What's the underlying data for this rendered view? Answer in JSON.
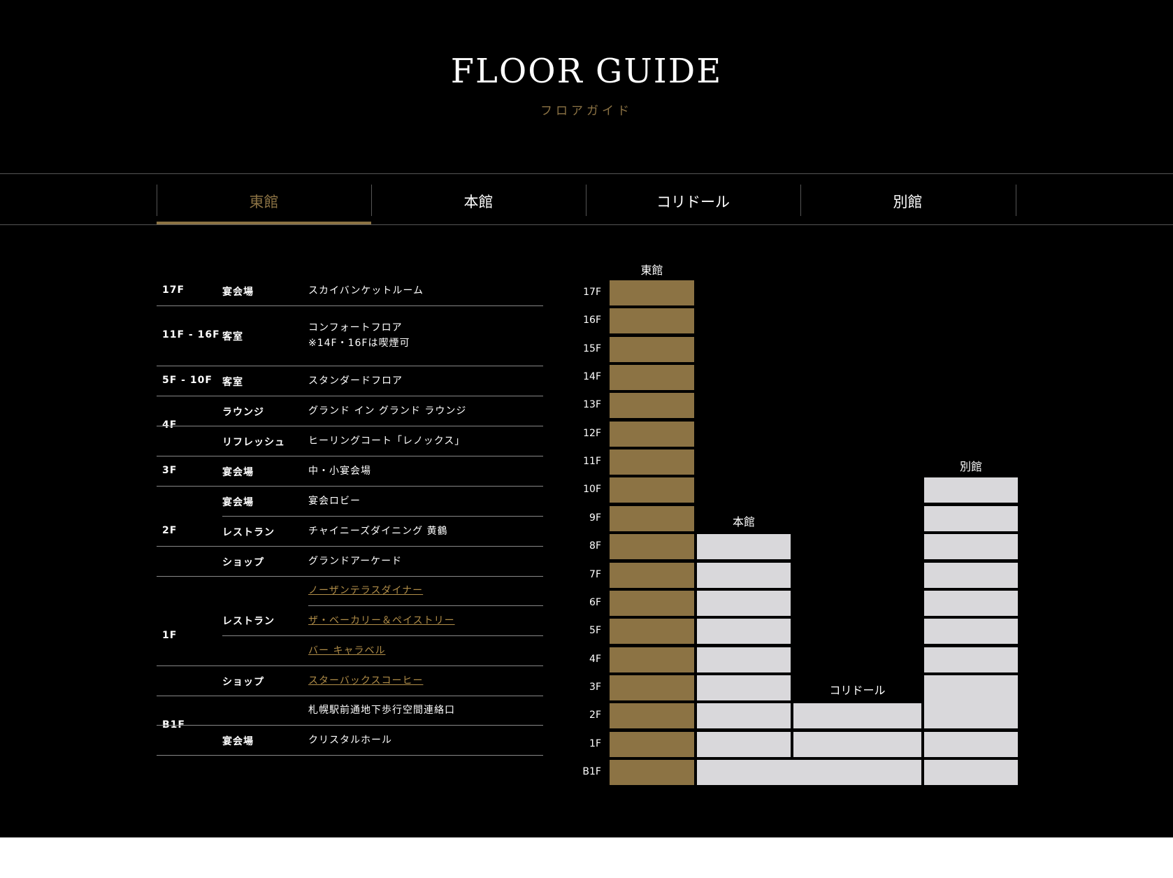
{
  "header": {
    "title": "FLOOR GUIDE",
    "subtitle": "フロアガイド"
  },
  "tabs": [
    {
      "label": "東館",
      "active": true
    },
    {
      "label": "本館",
      "active": false
    },
    {
      "label": "コリドール",
      "active": false
    },
    {
      "label": "別館",
      "active": false
    }
  ],
  "colors": {
    "accent": "#8c7344",
    "building_fill": "#d9d8db",
    "link": "#b08d48",
    "background": "#000000"
  },
  "floor_table": {
    "floors": [
      "17F",
      "11F - 16F",
      "5F - 10F",
      "4F",
      "3F",
      "2F",
      "1F",
      "B1F"
    ],
    "rows": [
      {
        "category": "宴会場",
        "name": "スカイバンケットルーム",
        "name2": ""
      },
      {
        "category": "客室",
        "name": "コンフォートフロア",
        "name2": "※14F・16Fは喫煙可"
      },
      {
        "category": "客室",
        "name": "スタンダードフロア",
        "name2": ""
      },
      {
        "category": "ラウンジ",
        "name": "グランド イン グランド ラウンジ",
        "name2": ""
      },
      {
        "category": "リフレッシュ",
        "name": "ヒーリングコート「レノックス」",
        "name2": ""
      },
      {
        "category": "宴会場",
        "name": "中・小宴会場",
        "name2": ""
      },
      {
        "category": "宴会場",
        "name": "宴会ロビー",
        "name2": ""
      },
      {
        "category": "レストラン",
        "name": "チャイニーズダイニング 黄鶴",
        "name2": ""
      },
      {
        "category": "ショップ",
        "name": "グランドアーケード",
        "name2": ""
      },
      {
        "category": "",
        "name": "ノーザンテラスダイナー",
        "name2": ""
      },
      {
        "category": "レストラン",
        "name": "ザ・ベーカリー＆ペイストリー",
        "name2": ""
      },
      {
        "category": "",
        "name": "バー キャラベル",
        "name2": ""
      },
      {
        "category": "ショップ",
        "name": "スターバックスコーヒー",
        "name2": ""
      },
      {
        "category": "",
        "name": "札幌駅前通地下歩行空間連絡口",
        "name2": ""
      },
      {
        "category": "宴会場",
        "name": "クリスタルホール",
        "name2": ""
      }
    ]
  },
  "building_diagram": {
    "floor_labels": [
      "17F",
      "16F",
      "15F",
      "14F",
      "13F",
      "12F",
      "11F",
      "10F",
      "9F",
      "8F",
      "7F",
      "6F",
      "5F",
      "4F",
      "3F",
      "2F",
      "1F",
      "B1F"
    ],
    "buildings": [
      {
        "label": "東館",
        "highlighted": true
      },
      {
        "label": "本館",
        "highlighted": false
      },
      {
        "label": "コリドール",
        "highlighted": false
      },
      {
        "label": "別館",
        "highlighted": false
      }
    ]
  }
}
